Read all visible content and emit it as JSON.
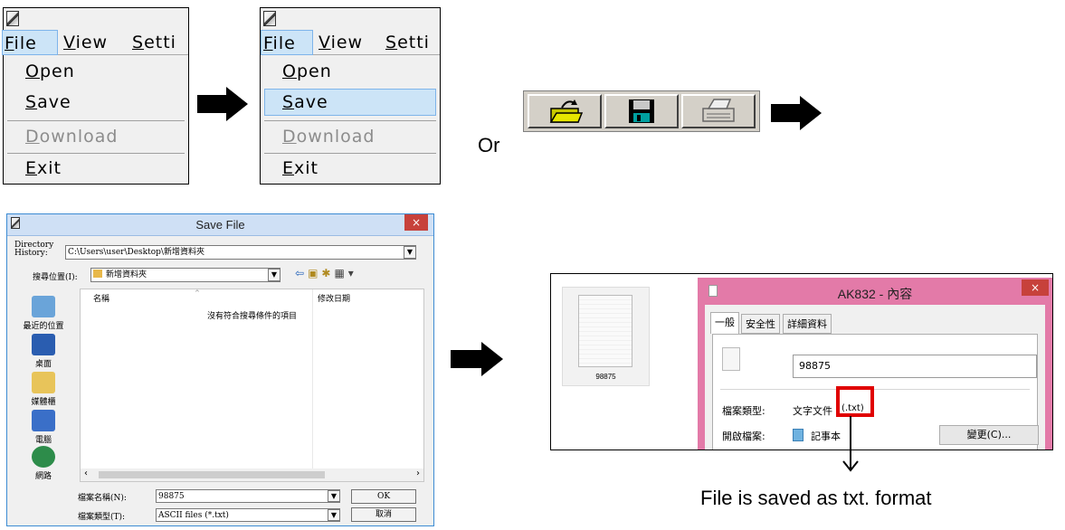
{
  "menu1": {
    "menubar": [
      {
        "label": "File",
        "key": "F",
        "rest": "ile"
      },
      {
        "label": "View",
        "key": "V",
        "rest": "iew"
      },
      {
        "label": "Setti",
        "key": "S",
        "rest": "etti"
      }
    ],
    "items": [
      {
        "key": "O",
        "rest": "pen",
        "disabled": false
      },
      {
        "key": "S",
        "rest": "ave",
        "disabled": false
      },
      {
        "key": "D",
        "rest": "ownload",
        "disabled": true
      },
      {
        "key": "E",
        "rest": "xit",
        "disabled": false
      }
    ]
  },
  "menu2": {
    "highlighted_item": "Save"
  },
  "or_label": "Or",
  "toolbar_icons": [
    "open-folder-icon",
    "save-floppy-icon",
    "print-icon"
  ],
  "save_dialog": {
    "title": "Save File",
    "close_glyph": "×",
    "history_label_1": "Directory",
    "history_label_2": "History:",
    "history_value": "C:\\Users\\user\\Desktop\\新增資料夾",
    "savein_label": "搜尋位置(I):",
    "savein_value": "新增資料夾",
    "col_name": "名稱",
    "col_modified": "修改日期",
    "empty_text": "沒有符合搜尋條件的項目",
    "sidebar": [
      {
        "label": "最近的位置",
        "icon": "recent-places-icon",
        "color": "#6aa4d9"
      },
      {
        "label": "桌面",
        "icon": "desktop-icon",
        "color": "#2a5db0"
      },
      {
        "label": "媒體櫃",
        "icon": "libraries-icon",
        "color": "#e8c45a"
      },
      {
        "label": "電腦",
        "icon": "computer-icon",
        "color": "#3a6fc8"
      },
      {
        "label": "網路",
        "icon": "network-icon",
        "color": "#2d8c4a"
      }
    ],
    "filename_label": "檔案名稱(N):",
    "filename_value": "98875",
    "filetype_label": "檔案類型(T):",
    "filetype_value": "ASCII files (*.txt)",
    "ok_label": "OK",
    "cancel_label": "取消"
  },
  "properties": {
    "file_tile_label": "98875",
    "title": "AK832 - 內容",
    "close_glyph": "×",
    "tabs": [
      "一般",
      "安全性",
      "詳細資料"
    ],
    "name_value": "98875",
    "type_label": "檔案類型:",
    "type_value_prefix": "文字文件",
    "type_value_ext": "(.txt)",
    "opens_label": "開啟檔案:",
    "opens_value": "記事本",
    "change_button": "變更(C)..."
  },
  "caption": "File is saved as txt. format",
  "colors": {
    "highlight": "#cce4f7",
    "highlight_border": "#7eb4ea",
    "callout_red": "#e00000",
    "prop_frame_pink": "#e37aa8",
    "dialog_border": "#3c8bd3"
  }
}
